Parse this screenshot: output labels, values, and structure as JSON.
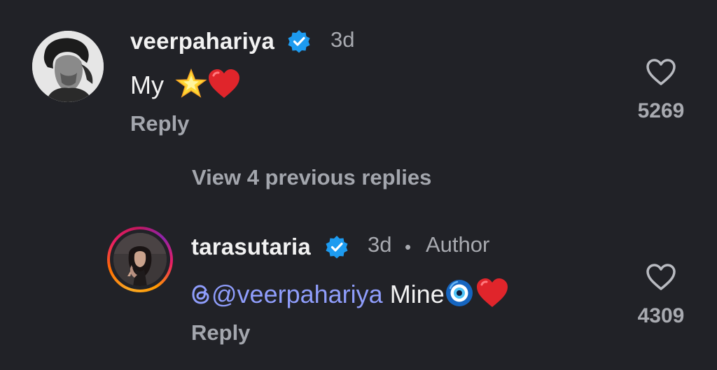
{
  "comments": [
    {
      "username": "veerpahariya",
      "time": "3d",
      "text": "My",
      "reply_label": "Reply",
      "likes": "5269"
    }
  ],
  "view_previous": "View 4 previous replies",
  "replies": [
    {
      "username": "tarasutaria",
      "time": "3d",
      "separator": "•",
      "author_badge": "Author",
      "mention": "@veerpahariya",
      "text": "Mine",
      "reply_label": "Reply",
      "likes": "4309"
    }
  ],
  "icons": {
    "verified": "verified-badge-icon",
    "like": "heart-outline-icon",
    "threads": "threads-logo-icon"
  },
  "colors": {
    "background": "#212227",
    "verified": "#1d9bf0",
    "mention": "#8f9dfb",
    "muted": "#a8aab0"
  }
}
